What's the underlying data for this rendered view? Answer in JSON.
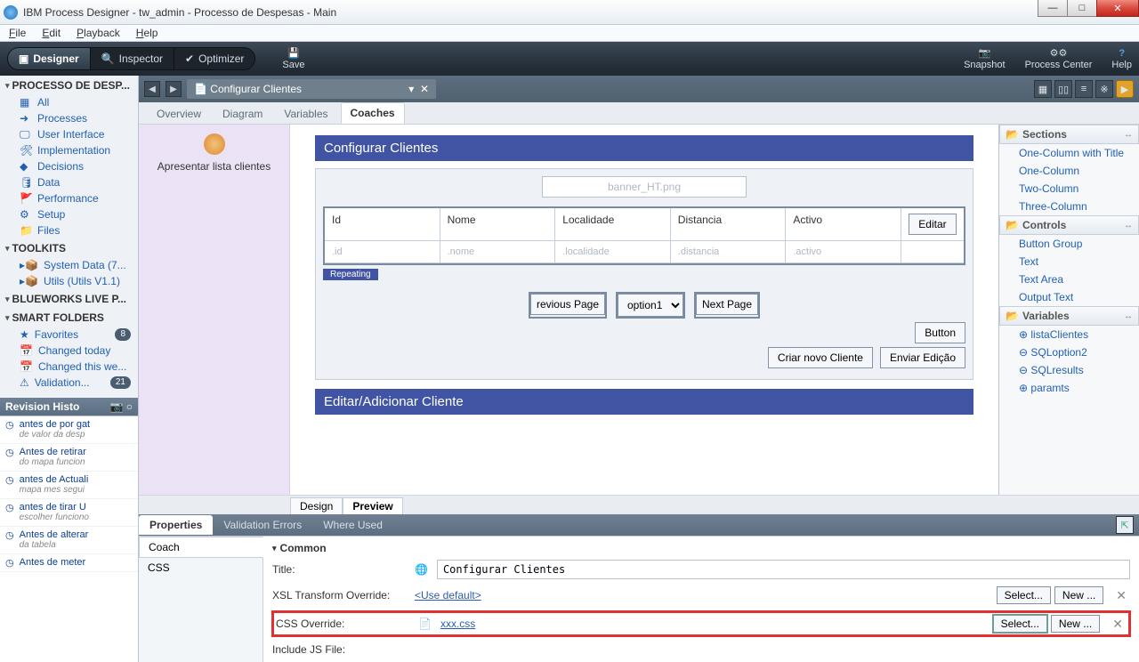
{
  "window": {
    "title": "IBM Process Designer -  tw_admin - Processo de Despesas - Main"
  },
  "menu": {
    "file": "File",
    "edit": "Edit",
    "playback": "Playback",
    "help": "Help"
  },
  "toolbar": {
    "designer": "Designer",
    "inspector": "Inspector",
    "optimizer": "Optimizer",
    "save": "Save",
    "snapshot": "Snapshot",
    "process_center": "Process Center",
    "help": "Help"
  },
  "docbar": {
    "title": "Configurar Clientes"
  },
  "subtabs": {
    "overview": "Overview",
    "diagram": "Diagram",
    "variables": "Variables",
    "coaches": "Coaches"
  },
  "coachleft": {
    "label": "Apresentar lista clientes"
  },
  "canvas": {
    "section1": "Configurar Clientes",
    "banner": "banner_HT.png",
    "cols": {
      "id": "Id",
      "nome": "Nome",
      "local": "Localidade",
      "dist": "Distancia",
      "activo": "Activo"
    },
    "ph": {
      "id": ".id",
      "nome": ".nome",
      "local": ".localidade",
      "dist": ".distancia",
      "activo": ".activo"
    },
    "editar": "Editar",
    "repeating": "Repeating",
    "prev": "revious Page",
    "option": "option1",
    "next": "Next Page",
    "button": "Button",
    "criar": "Criar novo Cliente",
    "enviar": "Enviar Edição",
    "section2": "Editar/Adicionar Cliente"
  },
  "designtabs": {
    "design": "Design",
    "preview": "Preview"
  },
  "sidebar": {
    "cat1": "PROCESSO DE DESP...",
    "items1": [
      "All",
      "Processes",
      "User Interface",
      "Implementation",
      "Decisions",
      "Data",
      "Performance",
      "Setup",
      "Files"
    ],
    "cat2": "TOOLKITS",
    "items2": [
      "System Data (7...",
      "Utils (Utils V1.1)"
    ],
    "cat3": "BLUEWORKS LIVE P...",
    "cat4": "SMART FOLDERS",
    "sfitems": [
      {
        "label": "Favorites",
        "badge": "8"
      },
      {
        "label": "Changed today"
      },
      {
        "label": "Changed this we..."
      },
      {
        "label": "Validation...",
        "badge": "21"
      }
    ],
    "revhead": "Revision Histo",
    "revs": [
      {
        "t": "antes de por gat",
        "s": "de valor da desp"
      },
      {
        "t": "Antes de retirar",
        "s": "do mapa funcion"
      },
      {
        "t": "antes de Actuali",
        "s": "mapa mes segui"
      },
      {
        "t": "antes de tirar U",
        "s": "escolher funciono"
      },
      {
        "t": "Antes de alterar",
        "s": "da tabela"
      },
      {
        "t": "Antes de meter",
        "s": ""
      }
    ]
  },
  "palette": {
    "sections": "Sections",
    "secitems": [
      "One-Column with Title",
      "One-Column",
      "Two-Column",
      "Three-Column"
    ],
    "controls": "Controls",
    "ctlitems": [
      "Button Group",
      "Text",
      "Text Area",
      "Output Text"
    ],
    "variables": "Variables",
    "varitems": [
      "listaClientes",
      "SQLoption2",
      "SQLresults",
      "paramts"
    ]
  },
  "props": {
    "tab_properties": "Properties",
    "tab_val": "Validation Errors",
    "tab_where": "Where Used",
    "left_coach": "Coach",
    "left_css": "CSS",
    "group": "Common",
    "title_label": "Title:",
    "title_value": "Configurar Clientes",
    "xsl_label": "XSL Transform Override:",
    "xsl_value": "<Use default>",
    "css_label": "CSS Override:",
    "css_value": "xxx.css",
    "js_label": "Include JS File:",
    "select": "Select...",
    "new": "New ..."
  }
}
